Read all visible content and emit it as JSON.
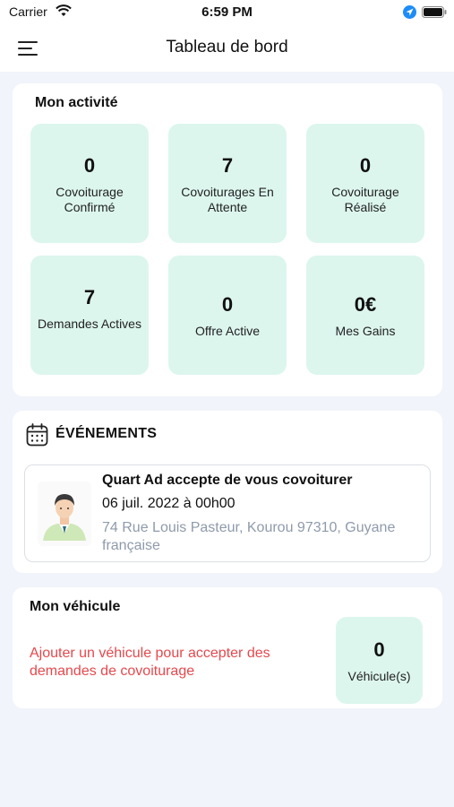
{
  "status_bar": {
    "carrier": "Carrier",
    "time": "6:59 PM"
  },
  "header": {
    "title": "Tableau de bord",
    "menu_icon": "hamburger-menu-icon"
  },
  "activity": {
    "title": "Mon activité",
    "tiles": [
      {
        "value": "0",
        "label": "Covoiturage Confirmé"
      },
      {
        "value": "7",
        "label": "Covoiturages En Attente"
      },
      {
        "value": "0",
        "label": "Covoiturage Réalisé"
      },
      {
        "value": "7",
        "label": "Demandes Actives"
      },
      {
        "value": "0",
        "label": "Offre Active"
      },
      {
        "value": "0€",
        "label": "Mes Gains"
      }
    ]
  },
  "events": {
    "title": "ÉVÉNEMENTS",
    "icon": "calendar-icon",
    "items": [
      {
        "title": "Quart Ad accepte de vous covoiturer",
        "date": "06 juil. 2022 à 00h00",
        "address": "74 Rue Louis Pasteur, Kourou 97310, Guyane française"
      }
    ]
  },
  "vehicle": {
    "title": "Mon véhicule",
    "message": "Ajouter un véhicule pour accepter des demandes de covoiturage",
    "count": "0",
    "count_label": "Véhicule(s)"
  },
  "colors": {
    "background": "#f1f4fa",
    "tile": "#dcf6ee",
    "warning_text": "#e5484d",
    "address_text": "#8f9aab"
  }
}
